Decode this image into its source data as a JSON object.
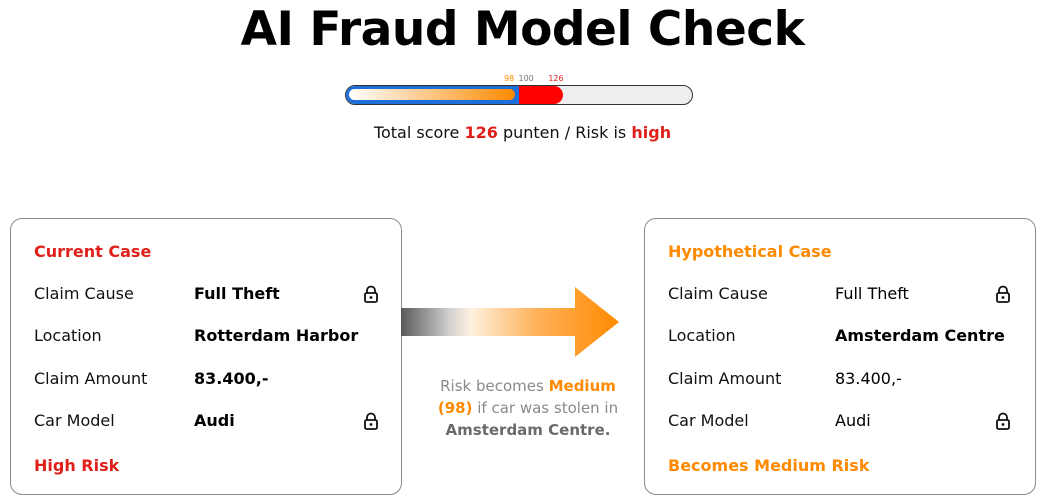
{
  "title": "AI Fraud Model Check",
  "score_bar": {
    "marker_98": "98",
    "marker_100": "100",
    "marker_126": "126",
    "hypothetical_score": 98,
    "threshold": 100,
    "current_score": 126,
    "scale_max": 200,
    "colors": {
      "blue": "#1e6fd9",
      "orange": "#ff8a00",
      "red": "#ff0000",
      "track": "#eeeeee"
    }
  },
  "score_text": {
    "prefix": "Total score",
    "value": "126",
    "middle": "punten / Risk is",
    "risk": "high"
  },
  "current_case": {
    "title": "Current Case",
    "rows": [
      {
        "key": "Claim Cause",
        "value": "Full Theft",
        "locked": true
      },
      {
        "key": "Location",
        "value": "Rotterdam Harbor",
        "locked": false
      },
      {
        "key": "Claim Amount",
        "value": "83.400,-",
        "locked": false
      },
      {
        "key": "Car Model",
        "value": "Audi",
        "locked": true
      }
    ],
    "footer": "High Risk"
  },
  "hypothetical_case": {
    "title": "Hypothetical Case",
    "rows": [
      {
        "key": "Claim Cause",
        "value": "Full Theft",
        "locked": true
      },
      {
        "key": "Location",
        "value": "Amsterdam Centre",
        "locked": false
      },
      {
        "key": "Claim Amount",
        "value": "83.400,-",
        "locked": false
      },
      {
        "key": "Car Model",
        "value": "Audi",
        "locked": true
      }
    ],
    "footer": "Becomes Medium Risk"
  },
  "caption": {
    "part1": "Risk becomes",
    "risk": "Medium",
    "score": "(98)",
    "part2": "if car was stolen in",
    "location": "Amsterdam Centre."
  },
  "icons": {
    "lock": "lock-icon",
    "arrow": "arrow-right-icon"
  },
  "colors": {
    "red": "#e0201a",
    "orange": "#ff8a00"
  }
}
